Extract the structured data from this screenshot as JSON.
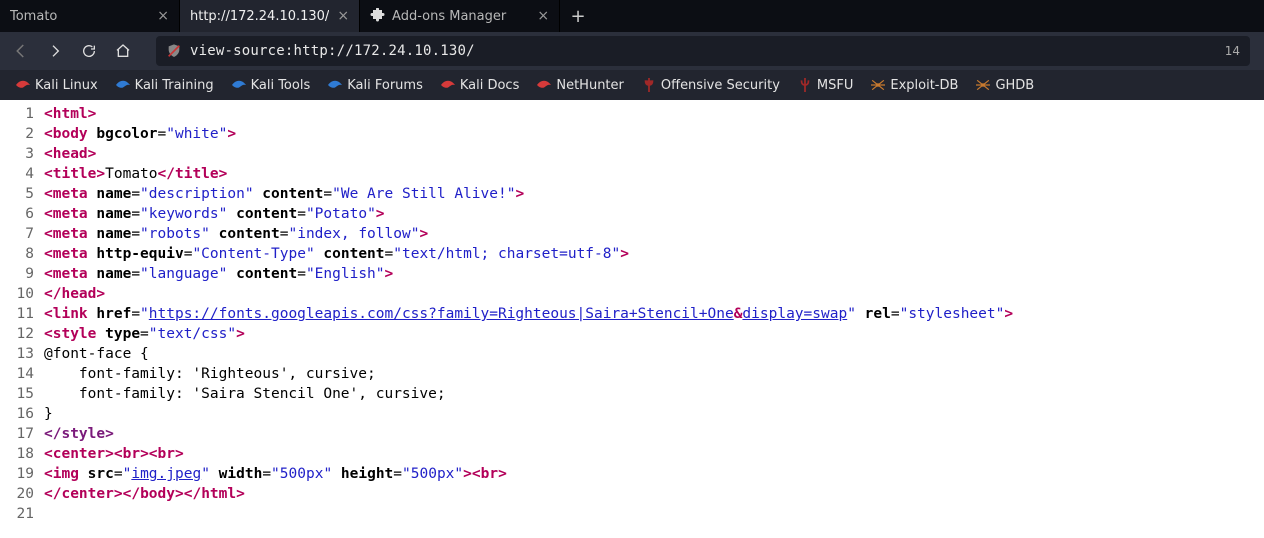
{
  "tabs": [
    {
      "label": "Tomato",
      "active": false,
      "hasAddon": false
    },
    {
      "label": "http://172.24.10.130/",
      "active": true,
      "hasAddon": false
    },
    {
      "label": "Add-ons Manager",
      "active": false,
      "hasAddon": true
    }
  ],
  "newtab_glyph": "+",
  "nav": {
    "url": "view-source:http://172.24.10.130/",
    "right_meta": "14"
  },
  "bookmarks": [
    {
      "label": "Kali Linux",
      "color": "#d63a3a"
    },
    {
      "label": "Kali Training",
      "color": "#2f7bd4"
    },
    {
      "label": "Kali Tools",
      "color": "#2f7bd4"
    },
    {
      "label": "Kali Forums",
      "color": "#2f7bd4"
    },
    {
      "label": "Kali Docs",
      "color": "#d63a3a"
    },
    {
      "label": "NetHunter",
      "color": "#d63a3a"
    },
    {
      "label": "Offensive Security",
      "color": "#a02828"
    },
    {
      "label": "MSFU",
      "color": "#a02828"
    },
    {
      "label": "Exploit-DB",
      "color": "#c87a2f"
    },
    {
      "label": "GHDB",
      "color": "#c87a2f"
    }
  ],
  "source_lines": {
    "l1": {
      "pre": "<",
      "tag": "html",
      "post": ">"
    },
    "l2": {
      "pre": "<",
      "tag": "body",
      "sp": " ",
      "a1": "bgcolor",
      "eq": "=",
      "q1": "\"",
      "v1": "white",
      "q2": "\"",
      "post": ">"
    },
    "l3": {
      "pre": "<",
      "tag": "head",
      "post": ">"
    },
    "l4": {
      "pre": "<",
      "tag": "title",
      "mid": ">",
      "text": "Tomato",
      "c1": "</",
      "ctag": "title",
      "c2": ">"
    },
    "l5": {
      "pre": "<",
      "tag": "meta",
      "sp": " ",
      "a1": "name",
      "eq": "=",
      "q1": "\"",
      "v1": "description",
      "q2": "\"",
      "sp2": " ",
      "a2": "content",
      "eq2": "=",
      "q3": "\"",
      "v2": "We Are Still Alive!",
      "q4": "\"",
      "post": ">"
    },
    "l6": {
      "pre": "<",
      "tag": "meta",
      "sp": " ",
      "a1": "name",
      "eq": "=",
      "q1": "\"",
      "v1": "keywords",
      "q2": "\"",
      "sp2": " ",
      "a2": "content",
      "eq2": "=",
      "q3": "\"",
      "v2": "Potato",
      "q4": "\"",
      "post": ">"
    },
    "l7": {
      "pre": "<",
      "tag": "meta",
      "sp": " ",
      "a1": "name",
      "eq": "=",
      "q1": "\"",
      "v1": "robots",
      "q2": "\"",
      "sp2": " ",
      "a2": "content",
      "eq2": "=",
      "q3": "\"",
      "v2": "index, follow",
      "q4": "\"",
      "post": ">"
    },
    "l8": {
      "pre": "<",
      "tag": "meta",
      "sp": " ",
      "a1": "http-equiv",
      "eq": "=",
      "q1": "\"",
      "v1": "Content-Type",
      "q2": "\"",
      "sp2": " ",
      "a2": "content",
      "eq2": "=",
      "q3": "\"",
      "v2": "text/html; charset=utf-8",
      "q4": "\"",
      "post": ">"
    },
    "l9": {
      "pre": "<",
      "tag": "meta",
      "sp": " ",
      "a1": "name",
      "eq": "=",
      "q1": "\"",
      "v1": "language",
      "q2": "\"",
      "sp2": " ",
      "a2": "content",
      "eq2": "=",
      "q3": "\"",
      "v2": "English",
      "q4": "\"",
      "post": ">"
    },
    "l10": {
      "pre": "</",
      "tag": "head",
      "post": ">"
    },
    "l11": {
      "pre": "<",
      "tag": "link",
      "sp": " ",
      "a1": "href",
      "eq": "=",
      "q1": "\"",
      "url1": "https://fonts.googleapis.com/css?family=Righteous|Saira+Stencil+One",
      "amp": "&",
      "url2": "display=swap",
      "q2": "\"",
      "sp2": " ",
      "a2": "rel",
      "eq2": "=",
      "q3": "\"",
      "v2": "stylesheet",
      "q4": "\"",
      "post": ">"
    },
    "l12": {
      "pre": "<",
      "tag": "style",
      "sp": " ",
      "a1": "type",
      "eq": "=",
      "q1": "\"",
      "v1": "text/css",
      "q2": "\"",
      "post": ">"
    },
    "l13": {
      "text": "@font-face {"
    },
    "l14": {
      "text": "    font-family: 'Righteous', cursive;"
    },
    "l15": {
      "text": "    font-family: 'Saira Stencil One', cursive;"
    },
    "l16": {
      "text": "}"
    },
    "l17": {
      "pre": "</",
      "tag": "style",
      "post": ">"
    },
    "l18": {
      "pre": "<",
      "tag": "center",
      "mid": ">",
      "t2": "<",
      "tag2": "br",
      "t3": ">",
      "t4": "<",
      "tag3": "br",
      "t5": ">"
    },
    "l19": {
      "pre": "<",
      "tag": "img",
      "sp": " ",
      "a1": "src",
      "eq": "=",
      "q1": "\"",
      "u": "img.jpeg",
      "q2": "\"",
      "sp2": " ",
      "a2": "width",
      "eq2": "=",
      "q3": "\"",
      "v2": "500px",
      "q4": "\"",
      "sp3": " ",
      "a3": "height",
      "eq3": "=",
      "q5": "\"",
      "v3": "500px",
      "q6": "\"",
      "post": ">",
      "t2": "<",
      "tag2": "br",
      "t3": ">"
    },
    "l20": {
      "p1": "</",
      "tag1": "center",
      "p2": ">",
      "p3": "</",
      "tag2": "body",
      "p4": ">",
      "p5": "</",
      "tag3": "html",
      "p6": ">"
    }
  },
  "line_numbers": [
    "1",
    "2",
    "3",
    "4",
    "5",
    "6",
    "7",
    "8",
    "9",
    "10",
    "11",
    "12",
    "13",
    "14",
    "15",
    "16",
    "17",
    "18",
    "19",
    "20",
    "21"
  ]
}
